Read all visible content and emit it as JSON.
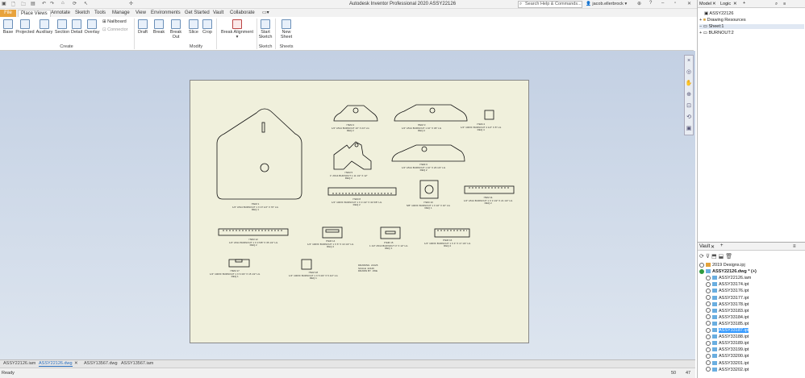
{
  "titlebar": {
    "title": "Autodesk Inventor Professional 2020    ASSY22126",
    "search_placeholder": "Search Help & Commands...",
    "user": "jacob.ellerbrock",
    "qa_icons": [
      "new-icon",
      "open-icon",
      "save-icon",
      "undo-icon",
      "redo-icon",
      "home-icon",
      "update-icon",
      "select-icon"
    ]
  },
  "tabs": [
    "File",
    "Place Views",
    "Annotate",
    "Sketch",
    "Tools",
    "Manage",
    "View",
    "Environments",
    "Get Started",
    "Vault",
    "Collaborate"
  ],
  "active_tab": "Place Views",
  "ribbon": {
    "create": [
      "Base",
      "Projected",
      "Auxiliary",
      "Section",
      "Detail",
      "Overlay"
    ],
    "create_small": [
      "Nailboard",
      "Connector"
    ],
    "modify": [
      "Draft",
      "Break",
      "Break Out",
      "Slice",
      "Crop"
    ],
    "break_alignment": "Break Alignment",
    "sketch": "Start\nSketch",
    "sheets": "New Sheet",
    "groups": [
      "Create",
      "Modify",
      "Sketch",
      "Sheets"
    ]
  },
  "browser": {
    "tabs": [
      "Model",
      "Logic"
    ],
    "root": "ASSY22126",
    "items": [
      "Drawing Resources",
      "Sheet:1",
      "BURNOUT:2"
    ]
  },
  "vault": {
    "title": "Vault",
    "items": [
      {
        "name": "2019 Designs.ipj",
        "selected": false
      },
      {
        "name": "ASSY22126.dwg * (+)",
        "selected": false,
        "bold": true
      },
      {
        "name": "ASSY22126.iam",
        "selected": false
      },
      {
        "name": "ASSY33174.ipt",
        "selected": false
      },
      {
        "name": "ASSY33176.ipt",
        "selected": false
      },
      {
        "name": "ASSY33177.ipt",
        "selected": false
      },
      {
        "name": "ASSY33178.ipt",
        "selected": false
      },
      {
        "name": "ASSY33183.ipt",
        "selected": false
      },
      {
        "name": "ASSY33184.ipt",
        "selected": false
      },
      {
        "name": "ASSY33185.ipt",
        "selected": false
      },
      {
        "name": "ASSY33187.ipt",
        "selected": true
      },
      {
        "name": "ASSY33188.ipt",
        "selected": false
      },
      {
        "name": "ASSY33189.ipt",
        "selected": false
      },
      {
        "name": "ASSY33199.ipt",
        "selected": false
      },
      {
        "name": "ASSY33200.ipt",
        "selected": false
      },
      {
        "name": "ASSY33201.ipt",
        "selected": false
      },
      {
        "name": "ASSY33202.ipt",
        "selected": false
      }
    ]
  },
  "doc_tabs": [
    "ASSY22126.iam",
    "ASSY22126.dwg",
    "ASSY13567.dwg",
    "ASSY13567.iam"
  ],
  "active_doc": "ASSY22126.dwg",
  "status": {
    "text": "Ready",
    "a": "50",
    "b": "47"
  },
  "sheet_notes": {
    "n1": "ITEM 1\n1/2\" A514 BURNOUT 1 X 47 1/2\" X 70\" LG\nREQ 1",
    "n2": "ITEM 2\n1/2\" A514 BURNOUT 10\" X 24\" LG\nREQ 2",
    "n3": "ITEM 3\n1/2\" A514 BURNOUT 1 10\" X 36\" LG\nREQ 2",
    "n4": "ITEM 4\n1/4\" 100XF BURNOUT 4 1/2\" X 8\" LG\nREQ 4",
    "n5": "ITEM 5\n1\" A514 BURNOUT 1 11 1/2\" X 12\"\nREQ 2",
    "n6": "ITEM 6\n1/2\" A514 BURNOUT 1 10\" X 26 1/2\" LG\nREQ 2",
    "n7": "ITEM 8\n1/4\" 100XF BURNOUT 1 X 3 1/2\" X 34 5/8\" LG\nREQ 2",
    "n8": "ITEM 10\n5/8\" 100XF BURNOUT 1 X 10\" X 10\" LG\nREQ 1",
    "n9": "ITEM 11\n1/2\" A514 BURNOUT 1 X 3 1/2\" X 21 1/2\" LG\nREQ 2",
    "n10": "ITEM 12\n1/2\" A514 BURNOUT 1 X 3 5/8\" X 35 1/2\" LG\nREQ 2",
    "n11": "ITEM 14\n1/4\" 100XF BURNOUT 1 X 6\" X 10 1/2\" LG\nREQ 2",
    "n12": "ITEM 15\n1 1/2\" A514 BURNOUT 4\" X 12\" LG\nREQ 1",
    "n13": "ITEM 16\n1/4\" 100XF BURNOUT 1 X 4\" X 17 1/4\" LG\nREQ 2",
    "n14": "ITEM 17\n1/4\" 100XF BURNOUT 1 X 6 3/4\" X 15 1/2\" LG\nREQ 1",
    "n15": "ITEM 18\n1/4\" 100XF BURNOUT 1 X 5 3/4\" X 5 1/2\" LG\nREQ 1",
    "n16": "DRAWING  22126\nSCALE  22126\nDRAWN BY  JWE"
  }
}
